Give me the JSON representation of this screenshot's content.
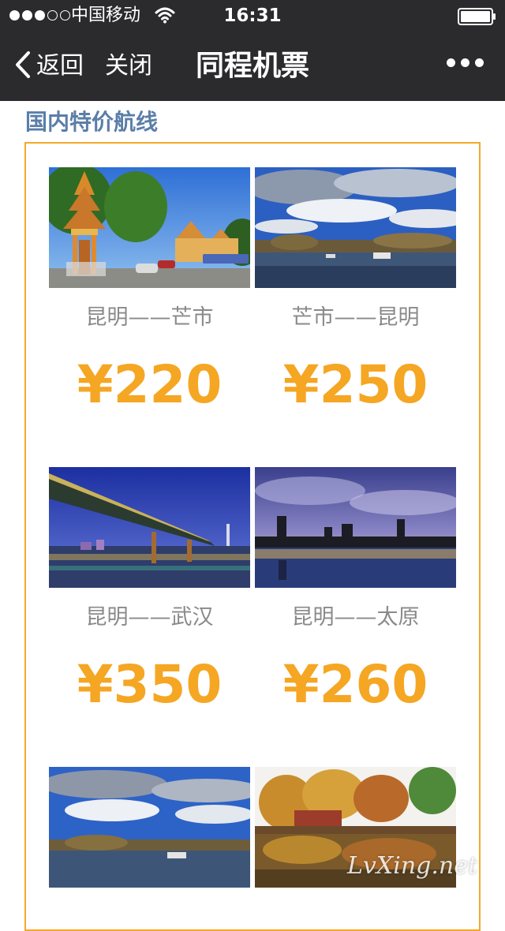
{
  "status_bar": {
    "carrier": "中国移动",
    "time": "16:31",
    "signal_bars_filled": 3,
    "signal_bars_total": 5
  },
  "nav": {
    "back_label": "返回",
    "close_label": "关闭",
    "title": "同程机票"
  },
  "section": {
    "title": "国内特价航线"
  },
  "routes": [
    {
      "name": "昆明——芒市",
      "price": "¥220"
    },
    {
      "name": "芒市——昆明",
      "price": "¥250"
    },
    {
      "name": "昆明——武汉",
      "price": "¥350"
    },
    {
      "name": "昆明——太原",
      "price": "¥260"
    },
    {
      "name": "",
      "price": ""
    },
    {
      "name": "",
      "price": ""
    }
  ],
  "watermark": "LvXing.net",
  "colors": {
    "bar_background": "#2b2b2d",
    "section_title": "#5b7ea8",
    "panel_border": "#f4a92a",
    "price": "#f5a623",
    "route_name": "#8a8a8a"
  }
}
